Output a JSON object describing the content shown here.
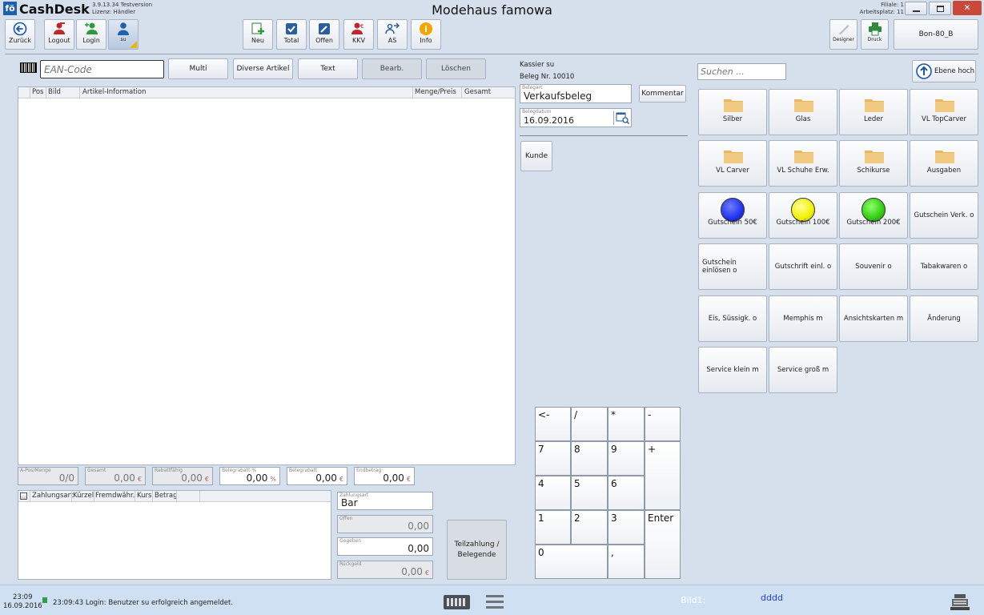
{
  "app": {
    "logo": "fö",
    "name": "CashDesk",
    "version": "3.9.13.34 Testversion",
    "license": "Lizenz: Händler",
    "title": "Modehaus famowa",
    "branch": "Filiale: 1",
    "workplace": "Arbeitsplatz: 11"
  },
  "toolbar": {
    "back": "Zurück",
    "logout": "Logout",
    "login": "Login",
    "user": "su",
    "new": "Neu",
    "total": "Total",
    "open": "Offen",
    "kkv": "KKV",
    "as": "AS",
    "info": "Info",
    "designer": "Designer",
    "print": "Druck",
    "bon": "Bon-80_B"
  },
  "entry": {
    "ean_placeholder": "EAN-Code",
    "multi": "Multi",
    "diverse": "Diverse Artikel",
    "text": "Text",
    "edit": "Bearb.",
    "delete": "Löschen"
  },
  "items_table": {
    "columns": [
      "Pos",
      "Bild",
      "Artikel-Information",
      "Menge/Preis",
      "Gesamt"
    ],
    "rows": []
  },
  "totals": {
    "apos_label": "A-Pos/Menge",
    "apos_value": "0/0",
    "gesamt_label": "Gesamt",
    "gesamt_value": "0,00",
    "rabattfaehig_label": "Rabattfähig",
    "rabattfaehig_value": "0,00",
    "belegrabatt_pct_label": "Belegrabatt-%",
    "belegrabatt_pct_value": "0,00",
    "belegrabatt_label": "Belegrabatt",
    "belegrabatt_value": "0,00",
    "endbetrag_label": "Endbetrag",
    "endbetrag_value": "0,00",
    "currency": "€",
    "percent": "%"
  },
  "payment_table": {
    "columns": [
      "Zahlungsart",
      "Kürzel",
      "Fremdwähr.",
      "Kurs",
      "Betrag"
    ],
    "rows": []
  },
  "payment": {
    "zahlungsart_label": "Zahlungsart",
    "zahlungsart_value": "Bar",
    "offen_label": "Offen",
    "offen_value": "0,00",
    "gegeben_label": "Gegeben",
    "gegeben_value": "0,00",
    "rueckgeld_label": "Rückgeld",
    "rueckgeld_value": "0,00",
    "currency": "€",
    "teilzahlung": "Teilzahlung / Belegende"
  },
  "receipt": {
    "cashier": "Kassier su",
    "number": "Beleg Nr. 10010",
    "type_label": "Belegart",
    "type_value": "Verkaufsbeleg",
    "comment": "Kommentar",
    "date_label": "Belegdatum",
    "date_value": "16.09.2016",
    "customer": "Kunde"
  },
  "numpad": {
    "back": "<-",
    "div": "/",
    "mul": "*",
    "minus": "-",
    "k7": "7",
    "k8": "8",
    "k9": "9",
    "plus": "+",
    "k4": "4",
    "k5": "5",
    "k6": "6",
    "k1": "1",
    "k2": "2",
    "k3": "3",
    "enter": "Enter",
    "k0": "0",
    "comma": ","
  },
  "catalog": {
    "search_placeholder": "Suchen ...",
    "up": "Ebene hoch",
    "tiles": {
      "silber": "Silber",
      "glas": "Glas",
      "leder": "Leder",
      "topcarver": "VL TopCarver",
      "carver": "VL Carver",
      "schuhe": "VL Schuhe Erw.",
      "schikurse": "Schikurse",
      "ausgaben": "Ausgaben",
      "gs50": "Gutschein 50€",
      "gs100": "Gutschein 100€",
      "gs200": "Gutschein 200€",
      "gsverk": "Gutschein Verk. o",
      "gseinl": "Gutschein einlösen o",
      "gutschrift": "Gutschrift einl. o",
      "souvenir": "Souvenir o",
      "tabak": "Tabakwaren o",
      "eis": "Eis, Süssigk. o",
      "memphis": "Memphis m",
      "ansicht": "Ansichtskarten m",
      "aenderung": "Änderung",
      "servklein": "Service klein m",
      "servgross": "Service groß m"
    },
    "colors": {
      "blue": "#2233ee",
      "yellow": "#f2f200",
      "green": "#33cc11",
      "folder": "#f0c27a"
    }
  },
  "status": {
    "time": "23:09",
    "date": "16.09.2016",
    "message": "23:09:43 Login: Benutzer su erfolgreich angemeldet.",
    "bild_label": "Bild1:",
    "bild_value": "dddd"
  }
}
